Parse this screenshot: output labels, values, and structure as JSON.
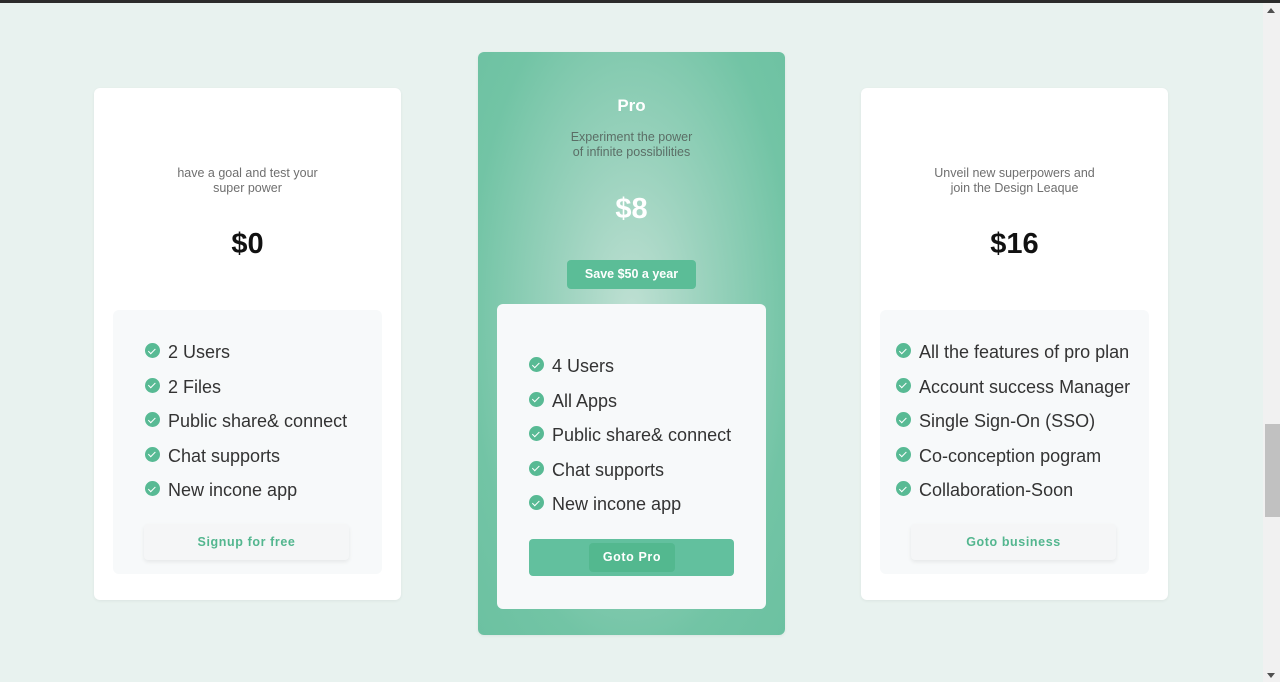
{
  "plans": {
    "free": {
      "description_line1": "have a goal and test your",
      "description_line2": "super power",
      "price": "$0",
      "features": [
        "2 Users",
        "2 Files",
        "Public share& connect",
        "Chat supports",
        "New incone app"
      ],
      "cta_label": "Signup for free"
    },
    "pro": {
      "title": "Pro",
      "description_line1": "Experiment the power",
      "description_line2": "of infinite possibilities",
      "price": "$8",
      "save_badge": "Save $50 a year",
      "features": [
        "4 Users",
        "All Apps",
        "Public share& connect",
        "Chat supports",
        "New incone app"
      ],
      "cta_label": "Goto Pro"
    },
    "business": {
      "description_line1": "Unveil new superpowers and",
      "description_line2": "join the Design Leaque",
      "price": "$16",
      "features": [
        "All the features of pro plan",
        "Account success Manager",
        "Single Sign-On (SSO)",
        "Co-conception pogram",
        "Collaboration-Soon"
      ],
      "cta_label": "Goto business"
    }
  },
  "colors": {
    "page_background": "#e8f2ef",
    "accent": "#58ba94",
    "pro_card": "#6cc1a1"
  },
  "icons": {
    "feature_bullet": "check-circle-icon"
  }
}
